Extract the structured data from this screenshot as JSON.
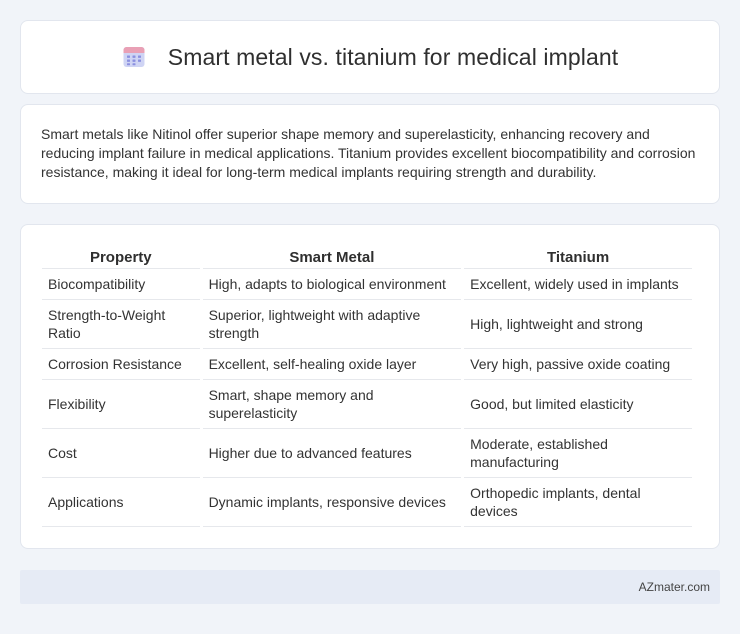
{
  "header": {
    "title": "Smart metal vs. titanium for medical implant",
    "icon": "calendar-icon",
    "icon_colors": {
      "top": "#e9a0b5",
      "body": "#cfd4f4",
      "dots": "#8b90e0"
    }
  },
  "description": "Smart metals like Nitinol offer superior shape memory and superelasticity, enhancing recovery and reducing implant failure in medical applications. Titanium provides excellent biocompatibility and corrosion resistance, making it ideal for long-term medical implants requiring strength and durability.",
  "table": {
    "headers": [
      "Property",
      "Smart Metal",
      "Titanium"
    ],
    "rows": [
      [
        "Biocompatibility",
        "High, adapts to biological environment",
        "Excellent, widely used in implants"
      ],
      [
        "Strength-to-Weight Ratio",
        "Superior, lightweight with adaptive strength",
        "High, lightweight and strong"
      ],
      [
        "Corrosion Resistance",
        "Excellent, self-healing oxide layer",
        "Very high, passive oxide coating"
      ],
      [
        "Flexibility",
        "Smart, shape memory and superelasticity",
        "Good, but limited elasticity"
      ],
      [
        "Cost",
        "Higher due to advanced features",
        "Moderate, established manufacturing"
      ],
      [
        "Applications",
        "Dynamic implants, responsive devices",
        "Orthopedic implants, dental devices"
      ]
    ]
  },
  "footer": {
    "text": "AZmater.com"
  }
}
